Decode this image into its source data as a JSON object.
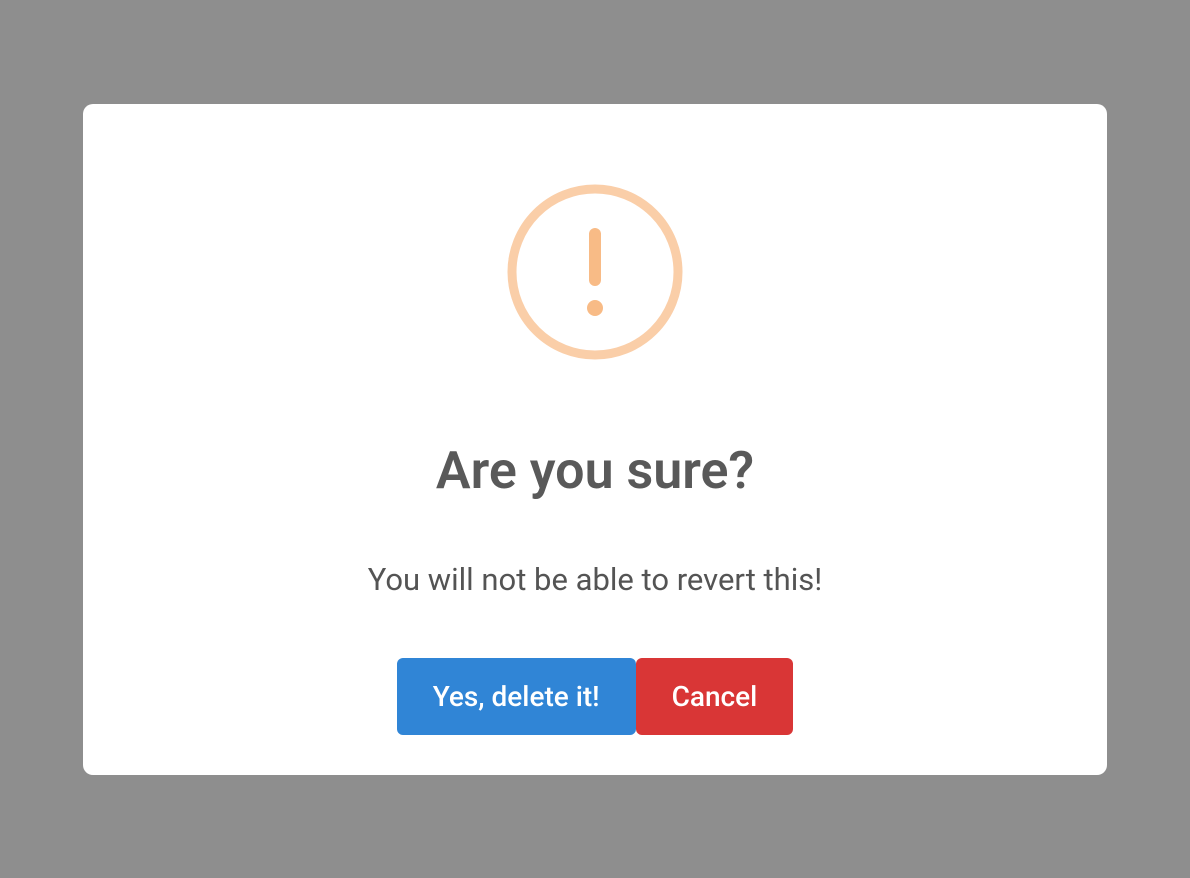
{
  "modal": {
    "icon": "warning-exclamation",
    "title": "Are you sure?",
    "message": "You will not be able to revert this!",
    "confirm_label": "Yes, delete it!",
    "cancel_label": "Cancel",
    "colors": {
      "icon": "#facea8",
      "confirm": "#3085d6",
      "cancel": "#d93636"
    }
  }
}
